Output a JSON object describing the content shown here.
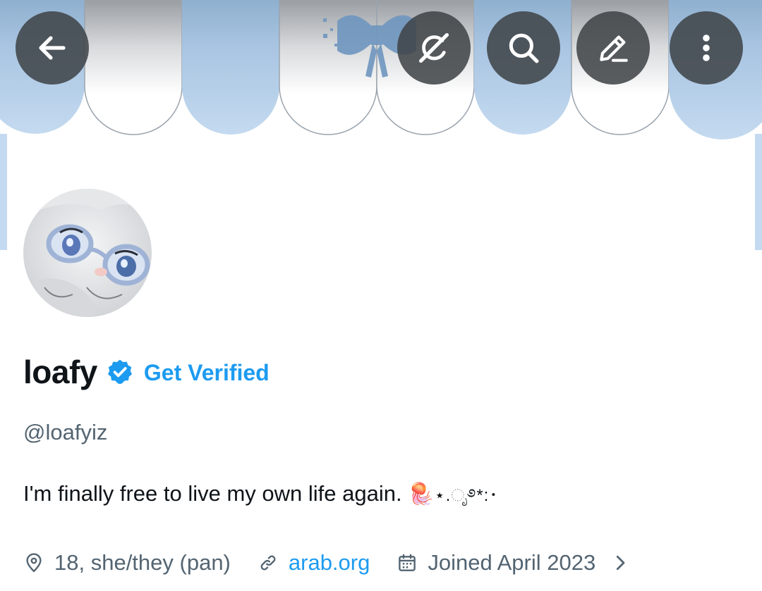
{
  "profile": {
    "display_name": "loafy",
    "get_verified_label": "Get Verified",
    "handle": "@loafyiz",
    "bio_text": "I'm finally free to live my own life again.",
    "bio_emoji": "🪼",
    "bio_decoration": "⋆.ೃ࿔*:･",
    "location": "18, she/they (pan)",
    "website": "arab.org",
    "joined": "Joined April 2023"
  },
  "icons": {
    "back": "arrow-left-icon",
    "grok": "grok-icon",
    "search": "search-icon",
    "edit": "edit-icon",
    "more": "more-vertical-icon",
    "verified": "verified-badge-icon",
    "location": "location-pin-icon",
    "link": "link-icon",
    "calendar": "calendar-icon",
    "chevron": "chevron-right-icon"
  },
  "colors": {
    "accent": "#1d9bf0",
    "text_primary": "#0f1419",
    "text_secondary": "#536471",
    "banner_blue": "#bcd4ec",
    "button_bg": "#3e4246"
  }
}
